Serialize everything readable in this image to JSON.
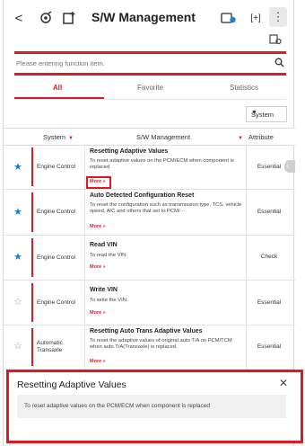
{
  "header": {
    "back_icon": "chevron-left-icon",
    "title": "S/W Management",
    "back_glyph": "<",
    "plus_glyph": "[+]",
    "menu_glyph": "⋮"
  },
  "search": {
    "placeholder": "Please entering function item."
  },
  "tabs": [
    {
      "label": "All",
      "active": true
    },
    {
      "label": "Favorite",
      "active": false
    },
    {
      "label": "Statistics",
      "active": false
    }
  ],
  "sort_select": {
    "value": "System"
  },
  "table": {
    "headers": {
      "system": "System",
      "sw": "S/W Management",
      "attribute": "Attribute"
    },
    "rows": [
      {
        "favorite": true,
        "system": "Engine Control",
        "function": "Resetting Adaptive Values",
        "description": "To reset adaptive values on the PCM/ECM when component is replaced",
        "more": "More »",
        "attribute": "Essential"
      },
      {
        "favorite": true,
        "system": "Engine Control",
        "function": "Auto Detected Configuration Reset",
        "description": "To reset the configuration such as transmission type, TCS, vehicle speed, A/C and others that set to PCM/···",
        "more": "More »",
        "attribute": "Essential"
      },
      {
        "favorite": true,
        "system": "Engine Control",
        "function": "Read VIN",
        "description": "To read the VIN.",
        "more": "More »",
        "attribute": "Check"
      },
      {
        "favorite": false,
        "system": "Engine Control",
        "function": "Write VIN",
        "description": "To write the VIN.",
        "more": "More »",
        "attribute": "Essential"
      },
      {
        "favorite": false,
        "system": "Automatic Transaxle",
        "function": "Resetting Auto Trans Adaptive Values",
        "description": "To reset the adaptive values of original auto T/A on PCM/TCM when auto T/A(Transaxle) is replaced.",
        "more": "More »",
        "attribute": "Essential"
      }
    ]
  },
  "popup": {
    "title": "Resetting Adaptive Values",
    "body": "To reset adaptive values on the PCM/ECM when component is replaced",
    "close_glyph": "✕"
  },
  "colors": {
    "accent": "#d61e2a",
    "star_on": "#1e7bd6",
    "highlight": "#e0181f"
  }
}
